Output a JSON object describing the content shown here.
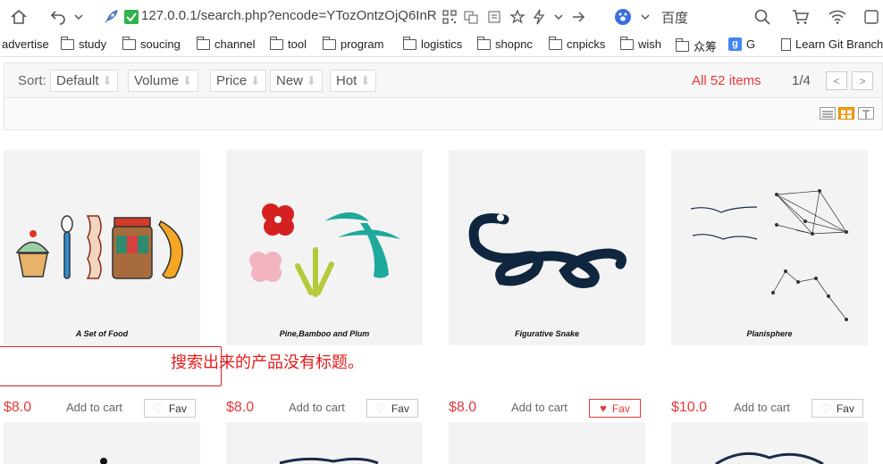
{
  "browser": {
    "url": "127.0.0.1/search.php?encode=YTozOntzOjQ6InR!",
    "search_engine": "百度"
  },
  "bookmarks": [
    {
      "label": "advertise",
      "type": "text"
    },
    {
      "label": "study",
      "type": "folder"
    },
    {
      "label": "soucing",
      "type": "folder"
    },
    {
      "label": "channel",
      "type": "folder"
    },
    {
      "label": "tool",
      "type": "folder"
    },
    {
      "label": "program",
      "type": "folder"
    },
    {
      "label": "logistics",
      "type": "folder"
    },
    {
      "label": "shopnc",
      "type": "folder"
    },
    {
      "label": "cnpicks",
      "type": "folder"
    },
    {
      "label": "wish",
      "type": "folder"
    },
    {
      "label": "众筹",
      "type": "folder"
    },
    {
      "label": "G",
      "type": "google"
    },
    {
      "label": "Learn Git Branch",
      "type": "page"
    }
  ],
  "sortbar": {
    "label": "Sort:",
    "buttons": [
      "Default",
      "Volume",
      "Price",
      "New",
      "Hot"
    ],
    "items_count": "All 52 items",
    "page": "1/4",
    "prev": "<",
    "next": ">"
  },
  "products": [
    {
      "caption": "A Set of Food",
      "price": "$8.0",
      "add_cart": "Add to cart",
      "fav": "Fav",
      "fav_active": false
    },
    {
      "caption": "Pine,Bamboo and Plum",
      "price": "$8.0",
      "add_cart": "Add to cart",
      "fav": "Fav",
      "fav_active": false
    },
    {
      "caption": "Figurative Snake",
      "price": "$8.0",
      "add_cart": "Add to cart",
      "fav": "Fav",
      "fav_active": true
    },
    {
      "caption": "Planisphere",
      "price": "$10.0",
      "add_cart": "Add to cart",
      "fav": "Fav",
      "fav_active": false
    }
  ],
  "annotation": {
    "text": "搜索出来的产品没有标题。"
  },
  "colors": {
    "accent_red": "#e4393c",
    "snake_navy": "#10263f",
    "pine_teal": "#1fa99b"
  }
}
